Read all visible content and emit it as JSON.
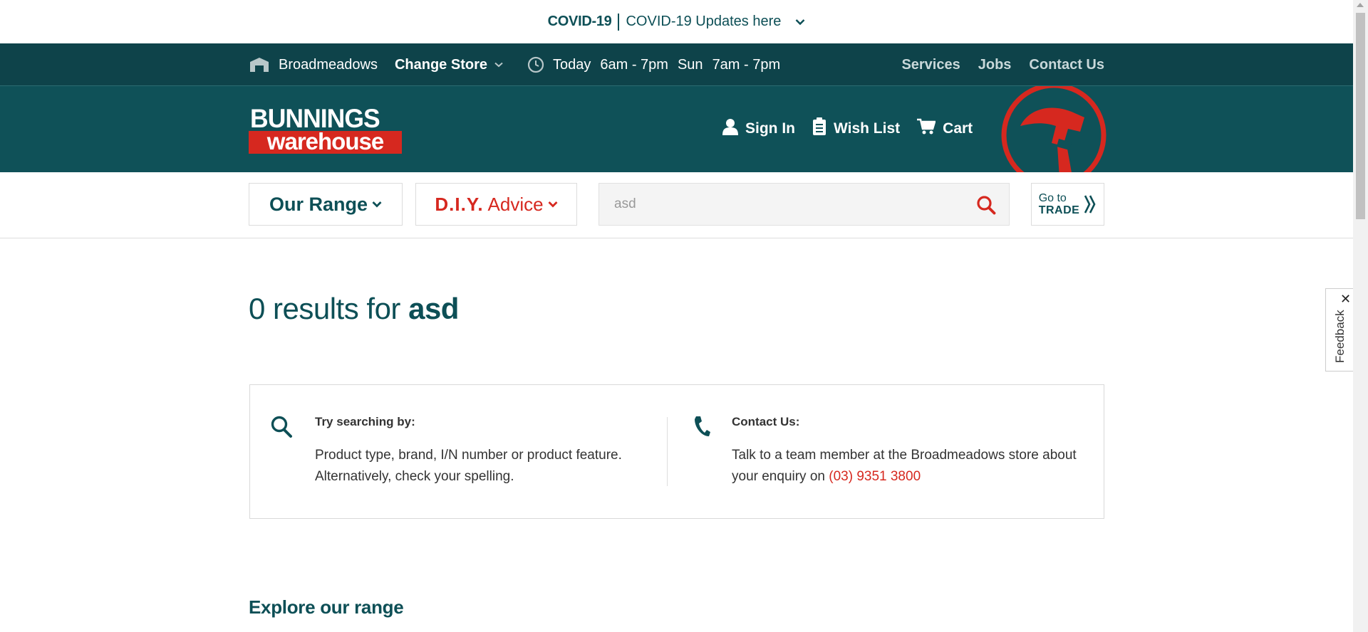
{
  "covid": {
    "title": "COVID-19",
    "link_text": "COVID-19 Updates here"
  },
  "store_bar": {
    "store_name": "Broadmeadows",
    "change_store": "Change Store",
    "hours_today_label": "Today",
    "hours_today": "6am - 7pm",
    "hours_sun_label": "Sun",
    "hours_sun": "7am - 7pm",
    "links": [
      "Services",
      "Jobs",
      "Contact Us"
    ]
  },
  "header": {
    "logo_top": "BUNNINGS",
    "logo_bottom": "warehouse",
    "sign_in": "Sign In",
    "wish_list": "Wish List",
    "cart": "Cart"
  },
  "nav": {
    "our_range": "Our Range",
    "diy_bold": "D.I.Y.",
    "diy_rest": "Advice",
    "search_value": "asd",
    "trade_line1": "Go to",
    "trade_line2": "TRADE"
  },
  "results": {
    "prefix": "0 results for",
    "query": "asd"
  },
  "tips": {
    "search_heading": "Try searching by:",
    "search_text": "Product type, brand, I/N number or product feature. Alternatively, check your spelling.",
    "contact_heading": "Contact Us:",
    "contact_text": "Talk to a team member at the Broadmeadows store about your enquiry on",
    "phone": "(03) 9351 3800"
  },
  "explore_heading": "Explore our range",
  "feedback": {
    "label": "Feedback",
    "close": "✕"
  },
  "colors": {
    "teal_dark": "#0e434a",
    "teal": "#0f5158",
    "red": "#d6281f"
  },
  "icons": [
    "store-icon",
    "chevron-down-icon",
    "clock-icon",
    "user-icon",
    "clipboard-icon",
    "cart-icon",
    "hammer-icon",
    "search-icon",
    "phone-icon",
    "double-chevron-right-icon",
    "close-icon"
  ]
}
